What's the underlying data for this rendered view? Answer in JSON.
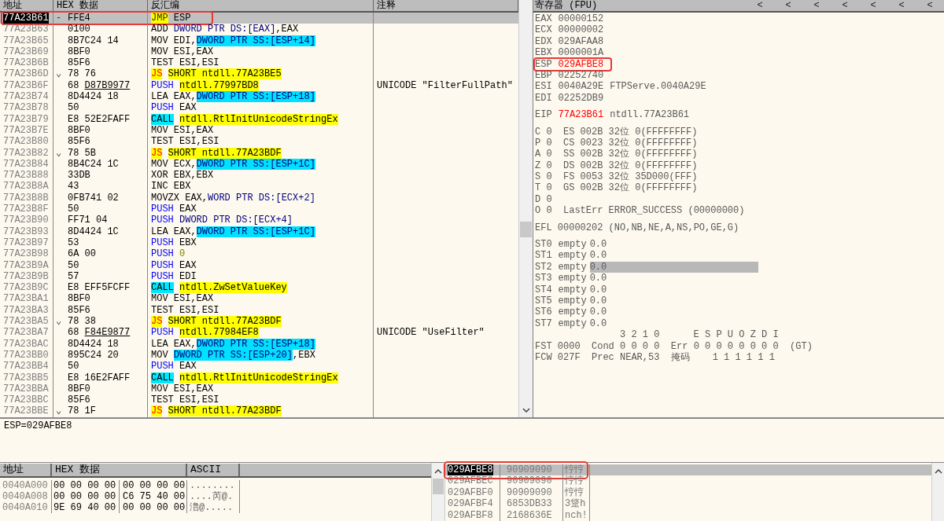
{
  "disassembly": {
    "columns": [
      "地址",
      "HEX 数据",
      "反汇编",
      "注释"
    ],
    "rows": [
      {
        "address": "77A23B61",
        "mark": "-",
        "hex": "FFE4",
        "code": [
          {
            "kind": "jmp",
            "text": "JMP",
            "space_before": false
          },
          {
            "kind": "plain",
            "text": "ESP",
            "space_before": true
          }
        ],
        "selected": true,
        "boxed": true
      },
      {
        "address": "77A23B63",
        "hex": "0100",
        "code": [
          {
            "kind": "plain",
            "text": "ADD",
            "space_before": false
          },
          {
            "kind": "ptr",
            "text": "DWORD PTR DS:[EAX]",
            "space_before": true
          },
          {
            "kind": "plain",
            "text": ",EAX",
            "space_before": false
          }
        ],
        "selected": false,
        "boxed": false
      },
      {
        "address": "77A23B65",
        "hex": "8B7C24 14",
        "code": [
          {
            "kind": "plain",
            "text": "MOV EDI,",
            "space_before": false
          },
          {
            "kind": "mem",
            "text": "DWORD PTR SS:[ESP+14]",
            "space_before": false
          }
        ],
        "selected": false,
        "boxed": false
      },
      {
        "address": "77A23B69",
        "hex": "8BF0",
        "code": [
          {
            "kind": "plain",
            "text": "MOV ESI,EAX",
            "space_before": false
          }
        ],
        "selected": false,
        "boxed": false
      },
      {
        "address": "77A23B6B",
        "hex": "85F6",
        "code": [
          {
            "kind": "plain",
            "text": "TEST ESI,ESI",
            "space_before": false
          }
        ],
        "selected": false,
        "boxed": false
      },
      {
        "address": "77A23B6D",
        "mark": "⌄",
        "hex": "78 76",
        "code": [
          {
            "kind": "jcc",
            "text": "JS",
            "space_before": false
          },
          {
            "kind": "target",
            "text": "SHORT ntdll.77A23BE5",
            "space_before": true
          }
        ],
        "selected": false,
        "boxed": false
      },
      {
        "address": "77A23B6F",
        "hex": "68",
        "hex_link": "D87B9977",
        "code": [
          {
            "kind": "push",
            "text": "PUSH",
            "space_before": false
          },
          {
            "kind": "target",
            "text": "ntdll.77997BD8",
            "space_before": true
          }
        ],
        "comment": "UNICODE \"FilterFullPath\"",
        "selected": false,
        "boxed": false
      },
      {
        "address": "77A23B74",
        "hex": "8D4424 18",
        "code": [
          {
            "kind": "plain",
            "text": "LEA EAX,",
            "space_before": false
          },
          {
            "kind": "mem",
            "text": "DWORD PTR SS:[ESP+18]",
            "space_before": false
          }
        ],
        "selected": false,
        "boxed": false
      },
      {
        "address": "77A23B78",
        "hex": "50",
        "code": [
          {
            "kind": "push",
            "text": "PUSH",
            "space_before": false
          },
          {
            "kind": "plain",
            "text": "EAX",
            "space_before": true
          }
        ],
        "selected": false,
        "boxed": false
      },
      {
        "address": "77A23B79",
        "hex": "E8 52E2FAFF",
        "code": [
          {
            "kind": "call",
            "text": "CALL",
            "space_before": false
          },
          {
            "kind": "target",
            "text": "ntdll.RtlInitUnicodeStringEx",
            "space_before": true
          }
        ],
        "selected": false,
        "boxed": false
      },
      {
        "address": "77A23B7E",
        "hex": "8BF0",
        "code": [
          {
            "kind": "plain",
            "text": "MOV ESI,EAX",
            "space_before": false
          }
        ],
        "selected": false,
        "boxed": false
      },
      {
        "address": "77A23B80",
        "hex": "85F6",
        "code": [
          {
            "kind": "plain",
            "text": "TEST ESI,ESI",
            "space_before": false
          }
        ],
        "selected": false,
        "boxed": false
      },
      {
        "address": "77A23B82",
        "mark": "⌄",
        "hex": "78 5B",
        "code": [
          {
            "kind": "jcc",
            "text": "JS",
            "space_before": false
          },
          {
            "kind": "target",
            "text": "SHORT ntdll.77A23BDF",
            "space_before": true
          }
        ],
        "selected": false,
        "boxed": false
      },
      {
        "address": "77A23B84",
        "hex": "8B4C24 1C",
        "code": [
          {
            "kind": "plain",
            "text": "MOV ECX,",
            "space_before": false
          },
          {
            "kind": "mem",
            "text": "DWORD PTR SS:[ESP+1C]",
            "space_before": false
          }
        ],
        "selected": false,
        "boxed": false
      },
      {
        "address": "77A23B88",
        "hex": "33DB",
        "code": [
          {
            "kind": "plain",
            "text": "XOR EBX,EBX",
            "space_before": false
          }
        ],
        "selected": false,
        "boxed": false
      },
      {
        "address": "77A23B8A",
        "hex": "43",
        "code": [
          {
            "kind": "plain",
            "text": "INC EBX",
            "space_before": false
          }
        ],
        "selected": false,
        "boxed": false
      },
      {
        "address": "77A23B8B",
        "hex": "0FB741 02",
        "code": [
          {
            "kind": "plain",
            "text": "MOVZX EAX,",
            "space_before": false
          },
          {
            "kind": "ptr",
            "text": "WORD PTR DS:[ECX+2]",
            "space_before": false
          }
        ],
        "selected": false,
        "boxed": false
      },
      {
        "address": "77A23B8F",
        "hex": "50",
        "code": [
          {
            "kind": "push",
            "text": "PUSH",
            "space_before": false
          },
          {
            "kind": "plain",
            "text": "EAX",
            "space_before": true
          }
        ],
        "selected": false,
        "boxed": false
      },
      {
        "address": "77A23B90",
        "hex": "FF71 04",
        "code": [
          {
            "kind": "push",
            "text": "PUSH",
            "space_before": false
          },
          {
            "kind": "ptr",
            "text": "DWORD PTR DS:[ECX+4]",
            "space_before": true
          }
        ],
        "selected": false,
        "boxed": false
      },
      {
        "address": "77A23B93",
        "hex": "8D4424 1C",
        "code": [
          {
            "kind": "plain",
            "text": "LEA EAX,",
            "space_before": false
          },
          {
            "kind": "mem",
            "text": "DWORD PTR SS:[ESP+1C]",
            "space_before": false
          }
        ],
        "selected": false,
        "boxed": false
      },
      {
        "address": "77A23B97",
        "hex": "53",
        "code": [
          {
            "kind": "push",
            "text": "PUSH",
            "space_before": false
          },
          {
            "kind": "plain",
            "text": "EBX",
            "space_before": true
          }
        ],
        "selected": false,
        "boxed": false
      },
      {
        "address": "77A23B98",
        "hex": "6A 00",
        "code": [
          {
            "kind": "push",
            "text": "PUSH",
            "space_before": false
          },
          {
            "kind": "num",
            "text": "0",
            "space_before": true
          }
        ],
        "selected": false,
        "boxed": false
      },
      {
        "address": "77A23B9A",
        "hex": "50",
        "code": [
          {
            "kind": "push",
            "text": "PUSH",
            "space_before": false
          },
          {
            "kind": "plain",
            "text": "EAX",
            "space_before": true
          }
        ],
        "selected": false,
        "boxed": false
      },
      {
        "address": "77A23B9B",
        "hex": "57",
        "code": [
          {
            "kind": "push",
            "text": "PUSH",
            "space_before": false
          },
          {
            "kind": "plain",
            "text": "EDI",
            "space_before": true
          }
        ],
        "selected": false,
        "boxed": false
      },
      {
        "address": "77A23B9C",
        "hex": "E8 EFF5FCFF",
        "code": [
          {
            "kind": "call",
            "text": "CALL",
            "space_before": false
          },
          {
            "kind": "target",
            "text": "ntdll.ZwSetValueKey",
            "space_before": true
          }
        ],
        "selected": false,
        "boxed": false
      },
      {
        "address": "77A23BA1",
        "hex": "8BF0",
        "code": [
          {
            "kind": "plain",
            "text": "MOV ESI,EAX",
            "space_before": false
          }
        ],
        "selected": false,
        "boxed": false
      },
      {
        "address": "77A23BA3",
        "hex": "85F6",
        "code": [
          {
            "kind": "plain",
            "text": "TEST ESI,ESI",
            "space_before": false
          }
        ],
        "selected": false,
        "boxed": false
      },
      {
        "address": "77A23BA5",
        "mark": "⌄",
        "hex": "78 38",
        "code": [
          {
            "kind": "jcc",
            "text": "JS",
            "space_before": false
          },
          {
            "kind": "target",
            "text": "SHORT ntdll.77A23BDF",
            "space_before": true
          }
        ],
        "selected": false,
        "boxed": false
      },
      {
        "address": "77A23BA7",
        "hex": "68",
        "hex_link": "F84E9877",
        "code": [
          {
            "kind": "push",
            "text": "PUSH",
            "space_before": false
          },
          {
            "kind": "target",
            "text": "ntdll.77984EF8",
            "space_before": true
          }
        ],
        "comment": "UNICODE \"UseFilter\"",
        "selected": false,
        "boxed": false
      },
      {
        "address": "77A23BAC",
        "hex": "8D4424 18",
        "code": [
          {
            "kind": "plain",
            "text": "LEA EAX,",
            "space_before": false
          },
          {
            "kind": "mem",
            "text": "DWORD PTR SS:[ESP+18]",
            "space_before": false
          }
        ],
        "selected": false,
        "boxed": false
      },
      {
        "address": "77A23BB0",
        "hex": "895C24 20",
        "code": [
          {
            "kind": "plain",
            "text": "MOV",
            "space_before": false
          },
          {
            "kind": "mem",
            "text": "DWORD PTR SS:[ESP+20]",
            "space_before": true
          },
          {
            "kind": "plain",
            "text": ",EBX",
            "space_before": false
          }
        ],
        "selected": false,
        "boxed": false
      },
      {
        "address": "77A23BB4",
        "hex": "50",
        "code": [
          {
            "kind": "push",
            "text": "PUSH",
            "space_before": false
          },
          {
            "kind": "plain",
            "text": "EAX",
            "space_before": true
          }
        ],
        "selected": false,
        "boxed": false
      },
      {
        "address": "77A23BB5",
        "hex": "E8 16E2FAFF",
        "code": [
          {
            "kind": "call",
            "text": "CALL",
            "space_before": false
          },
          {
            "kind": "target",
            "text": "ntdll.RtlInitUnicodeStringEx",
            "space_before": true
          }
        ],
        "selected": false,
        "boxed": false
      },
      {
        "address": "77A23BBA",
        "hex": "8BF0",
        "code": [
          {
            "kind": "plain",
            "text": "MOV ESI,EAX",
            "space_before": false
          }
        ],
        "selected": false,
        "boxed": false
      },
      {
        "address": "77A23BBC",
        "hex": "85F6",
        "code": [
          {
            "kind": "plain",
            "text": "TEST ESI,ESI",
            "space_before": false
          }
        ],
        "selected": false,
        "boxed": false
      },
      {
        "address": "77A23BBE",
        "mark": "⌄",
        "hex": "78 1F",
        "code": [
          {
            "kind": "jcc",
            "text": "JS",
            "space_before": false
          },
          {
            "kind": "target",
            "text": "SHORT ntdll.77A23BDF",
            "space_before": true
          }
        ],
        "selected": false,
        "boxed": false
      }
    ]
  },
  "registers": {
    "title": "寄存器 (FPU)",
    "header_buttons": [
      "<",
      "<",
      "<",
      "<",
      "<",
      "<",
      "<"
    ],
    "groups": [
      {
        "lines": [
          {
            "kind": "reg",
            "name": "EAX",
            "value": "00000152",
            "changed": false,
            "boxed": false
          },
          {
            "kind": "reg",
            "name": "ECX",
            "value": "00000002",
            "changed": false,
            "boxed": false
          },
          {
            "kind": "reg",
            "name": "EDX",
            "value": "029AFAA8",
            "changed": false,
            "boxed": false
          },
          {
            "kind": "reg",
            "name": "EBX",
            "value": "0000001A",
            "changed": false,
            "boxed": false
          },
          {
            "kind": "reg",
            "name": "ESP",
            "value": "029AFBE8",
            "changed": true,
            "boxed": true
          },
          {
            "kind": "reg",
            "name": "EBP",
            "value": "02252740",
            "changed": false,
            "boxed": false
          },
          {
            "kind": "reg",
            "name": "ESI",
            "value": "0040A29E",
            "comment": "FTPServe.0040A29E",
            "changed": false,
            "boxed": false
          },
          {
            "kind": "reg",
            "name": "EDI",
            "value": "02252DB9",
            "changed": false,
            "boxed": false
          }
        ]
      },
      {
        "lines": [
          {
            "kind": "reg",
            "name": "EIP",
            "value": "77A23B61",
            "comment": "ntdll.77A23B61",
            "changed": true,
            "boxed": false
          }
        ]
      },
      {
        "lines": [
          {
            "kind": "text",
            "text": "C 0  ES 002B 32位 0(FFFFFFFF)"
          },
          {
            "kind": "text",
            "text": "P 0  CS 0023 32位 0(FFFFFFFF)"
          },
          {
            "kind": "text",
            "text": "A 0  SS 002B 32位 0(FFFFFFFF)"
          },
          {
            "kind": "text",
            "text": "Z 0  DS 002B 32位 0(FFFFFFFF)"
          },
          {
            "kind": "text",
            "text": "S 0  FS 0053 32位 35D000(FFF)"
          },
          {
            "kind": "text",
            "text": "T 0  GS 002B 32位 0(FFFFFFFF)"
          },
          {
            "kind": "text",
            "text": "D 0"
          },
          {
            "kind": "text",
            "text": "O 0  LastErr ERROR_SUCCESS (00000000)"
          }
        ]
      },
      {
        "lines": [
          {
            "kind": "text",
            "text": "EFL 00000202 (NO,NB,NE,A,NS,PO,GE,G)"
          }
        ]
      },
      {
        "lines": [
          {
            "kind": "fpu",
            "name": "ST0",
            "tag": "empty",
            "value": "0.0",
            "selected": false
          },
          {
            "kind": "fpu",
            "name": "ST1",
            "tag": "empty",
            "value": "0.0",
            "selected": false
          },
          {
            "kind": "fpu",
            "name": "ST2",
            "tag": "empty",
            "value": "0.0",
            "selected": true
          },
          {
            "kind": "fpu",
            "name": "ST3",
            "tag": "empty",
            "value": "0.0",
            "selected": false
          },
          {
            "kind": "fpu",
            "name": "ST4",
            "tag": "empty",
            "value": "0.0",
            "selected": false
          },
          {
            "kind": "fpu",
            "name": "ST5",
            "tag": "empty",
            "value": "0.0",
            "selected": false
          },
          {
            "kind": "fpu",
            "name": "ST6",
            "tag": "empty",
            "value": "0.0",
            "selected": false
          },
          {
            "kind": "fpu",
            "name": "ST7",
            "tag": "empty",
            "value": "0.0",
            "selected": false
          },
          {
            "kind": "caption",
            "text": "3 2 1 0      E S P U O Z D I"
          },
          {
            "kind": "text",
            "text": "FST 0000  Cond 0 0 0 0  Err 0 0 0 0 0 0 0 0  (GT)"
          },
          {
            "kind": "text",
            "text": "FCW 027F  Prec NEAR,53  掩码    1 1 1 1 1 1"
          }
        ]
      }
    ]
  },
  "info": {
    "text": "ESP=029AFBE8"
  },
  "dump": {
    "columns": [
      "地址",
      "HEX 数据",
      "ASCII"
    ],
    "rows": [
      {
        "address": "0040A000",
        "hex_1": "00 00 00 00",
        "hex_2": "00 00 00 00",
        "ascii": "........"
      },
      {
        "address": "0040A008",
        "hex_1": "00 00 00 00",
        "hex_2": "C6 75 40 00",
        "ascii": "....芮@."
      },
      {
        "address": "0040A010",
        "hex_1": "9E 69 40 00",
        "hex_2": "00 00 00 00",
        "ascii": "澛@....."
      }
    ]
  },
  "stack": {
    "rows": [
      {
        "address": "029AFBE8",
        "value": "90909090",
        "ascii": "悙悙",
        "selected": true,
        "boxed": true
      },
      {
        "address": "029AFBEC",
        "value": "90909090",
        "ascii": "悙悙",
        "selected": false,
        "boxed": false
      },
      {
        "address": "029AFBF0",
        "value": "90909090",
        "ascii": "悙悙",
        "selected": false,
        "boxed": false
      },
      {
        "address": "029AFBF4",
        "value": "6853DB33",
        "ascii": "3跾h",
        "selected": false,
        "boxed": false
      },
      {
        "address": "029AFBF8",
        "value": "2168636E",
        "ascii": "nch!",
        "selected": false,
        "boxed": false
      }
    ]
  }
}
